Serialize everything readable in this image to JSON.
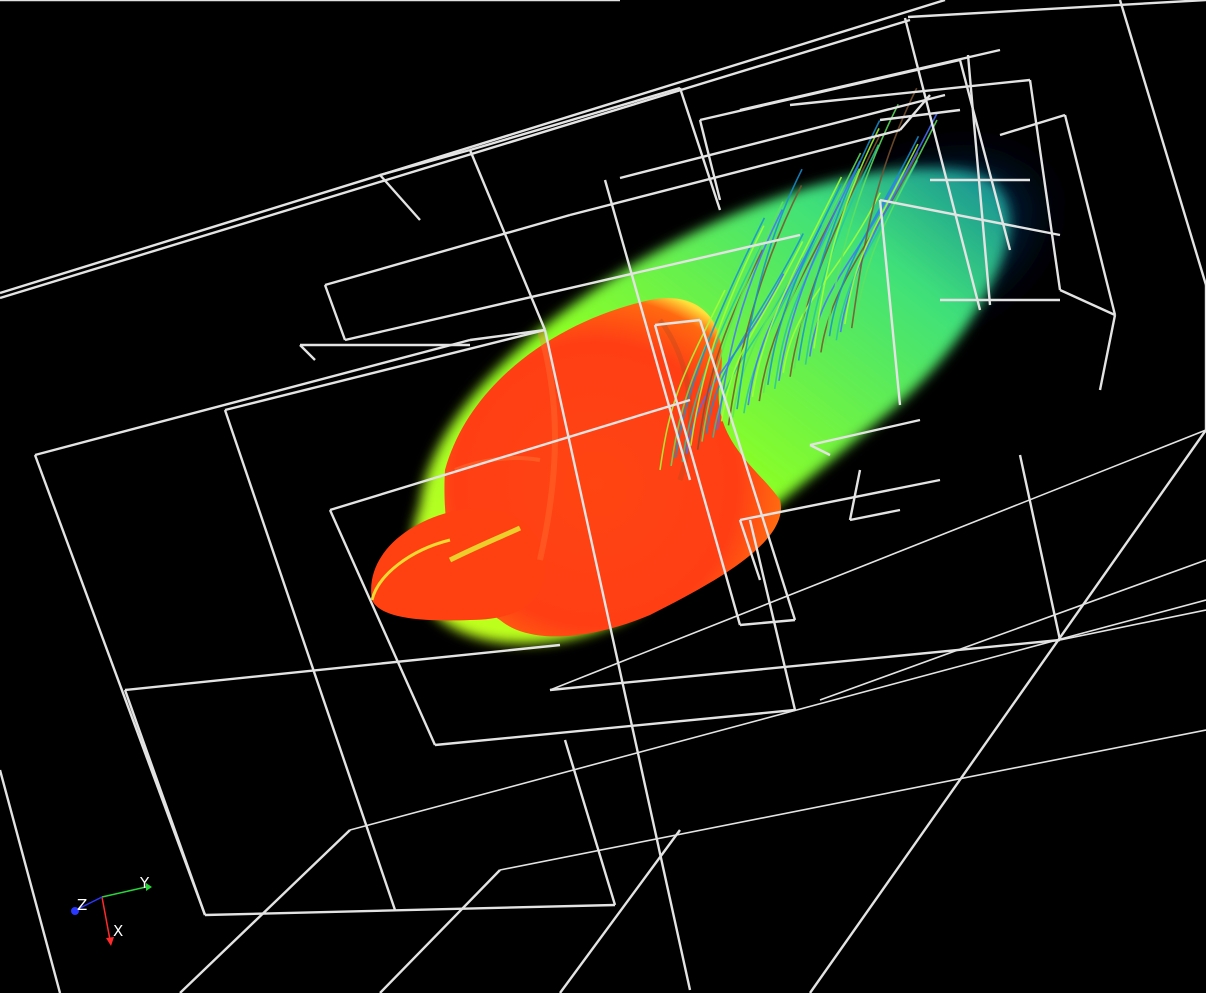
{
  "scene": {
    "background_color": "#000000",
    "wireframe_color": "#e6e6e6",
    "volume_colormap": [
      "#ff3a10",
      "#ff5a1a",
      "#f7ff2a",
      "#7dff1f",
      "#2fe07a",
      "#17a4b5",
      "#0d4f8a",
      "#031d3a"
    ],
    "streamline_colors": [
      "#a6ff3a",
      "#5ee35f",
      "#28c5a0",
      "#1a8fd0",
      "#4a70ff",
      "#7a5230"
    ]
  },
  "orientation_axes": {
    "x_label": "X",
    "y_label": "Y",
    "z_label": "Z",
    "x_color": "#ff2a2a",
    "y_color": "#27d63a",
    "z_color": "#2a38ff"
  }
}
